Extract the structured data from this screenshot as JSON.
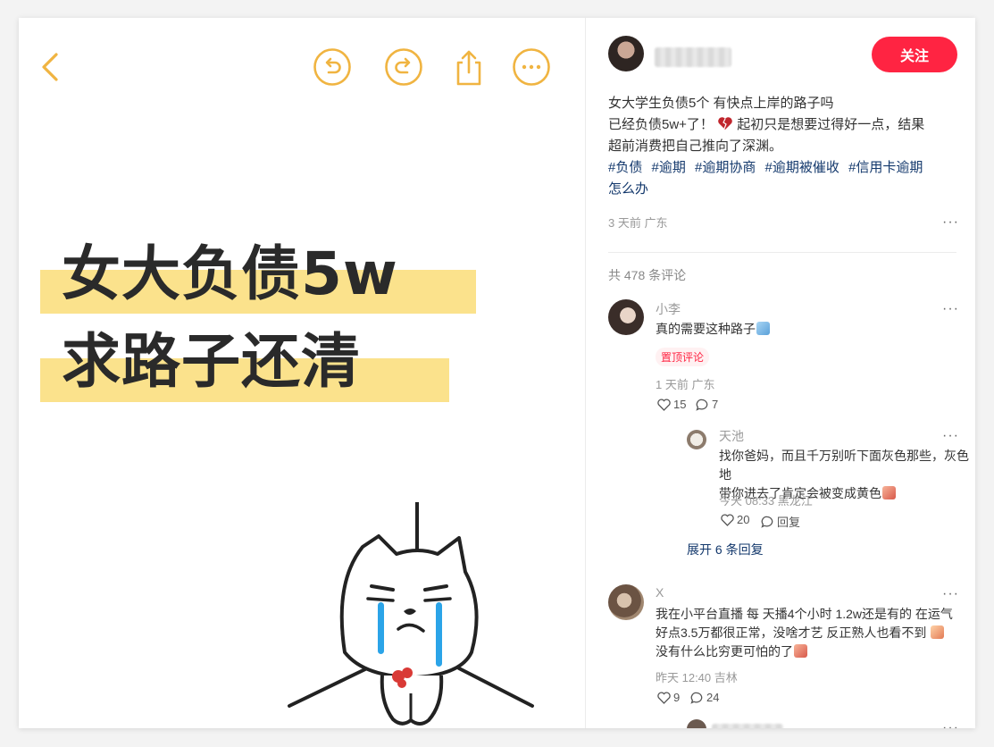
{
  "toolbar": {
    "icons": [
      "chevron-left-icon",
      "undo-icon",
      "redo-icon",
      "share-icon",
      "more-icon"
    ],
    "accent": "#f0b441"
  },
  "cover": {
    "line1": "女大负债5w",
    "line2": "求路子还清",
    "highlight_color": "#fbe28c"
  },
  "author": {
    "follow_label": "关注"
  },
  "post": {
    "title": "女大学生负债5个 有快点上岸的路子吗",
    "body_line1_a": "已经负债5w+了！",
    "body_line1_b": "起初只是想要过得好一点，结果",
    "body_line2": "超前消费把自己推向了深渊。",
    "tags": [
      "#负债",
      "#逾期",
      "#逾期协商",
      "#逾期被催收",
      "#信用卡逾期"
    ],
    "tag_wrap": "怎么办",
    "time": "3 天前",
    "location": "广东"
  },
  "comments_total": "共 478 条评论",
  "comments": [
    {
      "name": "小李",
      "text": "真的需要这种路子",
      "badge": "置顶评论",
      "time": "1 天前",
      "location": "广东",
      "likes": "15",
      "replies": "7"
    },
    {
      "name": "X",
      "line1": "我在小平台直播 每 天播4个小时 1.2w还是有的 在运气",
      "line2": "好点3.5万都很正常，没啥才艺 反正熟人也看不到",
      "line3": "没有什么比穷更可怕的了",
      "time": "昨天 12:40",
      "location": "吉林",
      "likes": "9",
      "replies": "24"
    }
  ],
  "reply": {
    "name": "天池",
    "line1": "找你爸妈，而且千万别听下面灰色那些，灰色地",
    "line2": "带你进去了肯定会被变成黄色",
    "time": "今天 08:33",
    "location": "黑龙江",
    "likes": "20",
    "reply_label": "回复"
  },
  "expand_label": "展开 6 条回复",
  "more_glyph": "···"
}
